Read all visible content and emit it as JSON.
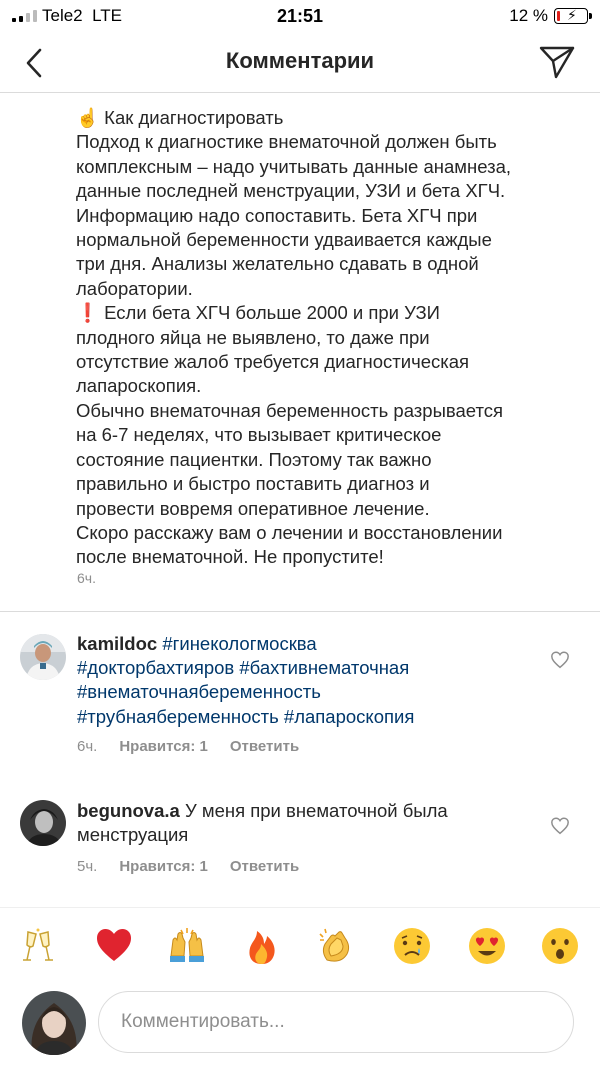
{
  "status_bar": {
    "carrier": "Tele2",
    "network": "LTE",
    "time": "21:51",
    "battery_text": "12 %",
    "battery_level": 0.12
  },
  "nav": {
    "title": "Комментарии",
    "back_icon": "chevron-left-icon",
    "send_icon": "paper-plane-icon"
  },
  "post": {
    "caption_lines": [
      "☝️ Как диагностировать",
      "Подход к диагностике внематочной должен быть",
      "комплексным – надо учитывать данные анамнеза,",
      "данные последней менструации, УЗИ и бета ХГЧ.",
      "Информацию надо сопоставить. Бета ХГЧ при",
      "нормальной беременности удваивается каждые",
      "три дня. Анализы желательно сдавать в одной",
      "лаборатории.",
      "❗ Если бета ХГЧ больше 2000 и при УЗИ",
      "плодного яйца не выявлено, то даже при",
      "отсутствие жалоб требуется диагностическая",
      "лапароскопия.",
      "Обычно внематочная беременность разрывается",
      "на 6-7 неделях, что вызывает критическое",
      "состояние пациентки. Поэтому так важно",
      "правильно и быстро поставить диагноз и",
      "провести вовремя оперативное лечение.",
      "Скоро расскажу вам о лечении и восстановлении",
      "после внематочной. Не пропустите!"
    ],
    "time": "6ч."
  },
  "comments": [
    {
      "username": "kamildoc",
      "tag_1": "#гинекологмосква",
      "tag_2": "#докторбахтияров",
      "tag_3": "#бахтивнематочная",
      "tag_4": "#внематочнаябеременность",
      "tag_5": "#трубнаябеременность",
      "tag_6": "#лапароскопия",
      "time": "6ч.",
      "likes": "Нравится: 1",
      "reply": "Ответить"
    },
    {
      "username": "begunova.a",
      "text_1": "У меня при внематочной была",
      "text_2": "менструация",
      "time": "5ч.",
      "likes": "Нравится: 1",
      "reply": "Ответить"
    }
  ],
  "emoji_bar": [
    "🥂",
    "❤️",
    "🙌",
    "🔥",
    "👏",
    "😢",
    "😍",
    "😮"
  ],
  "composer": {
    "placeholder": "Комментировать..."
  },
  "colors": {
    "text": "#262626",
    "secondary": "#8e8e8e",
    "hashtag": "#00376b",
    "divider": "#dbdbdb",
    "battery_low": "#e0201b"
  }
}
